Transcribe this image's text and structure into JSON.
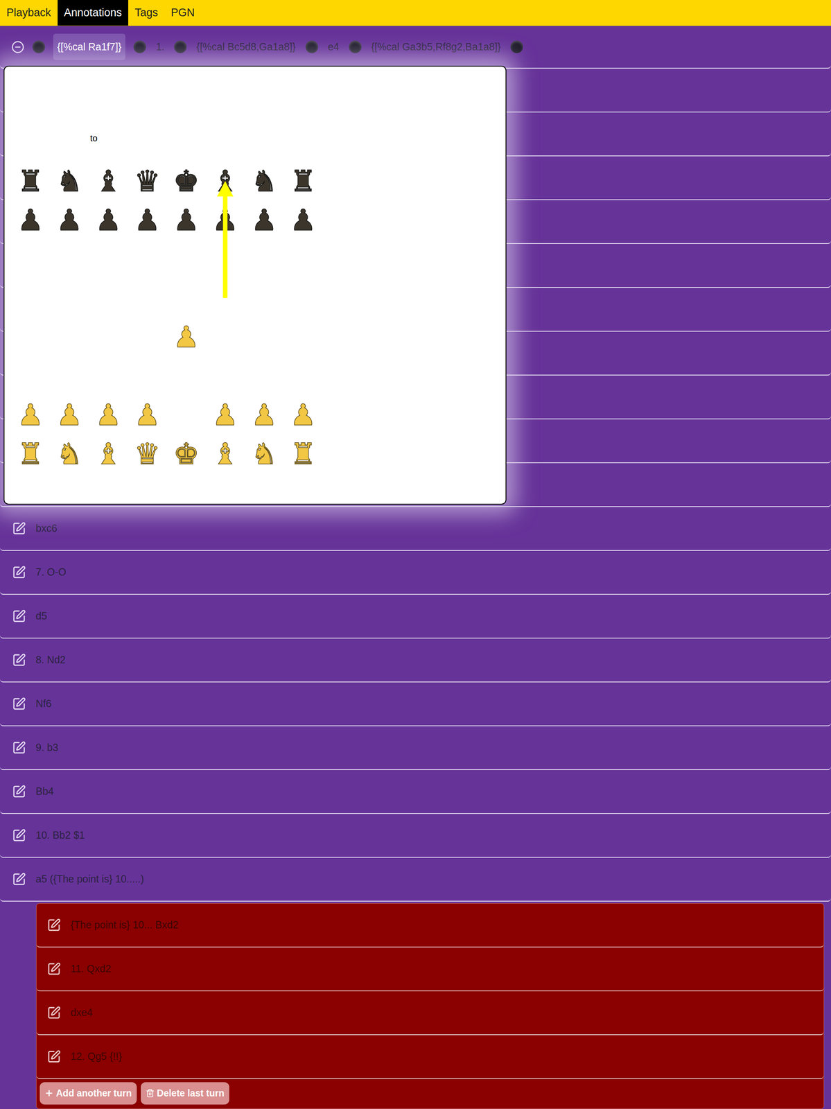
{
  "nav": {
    "tabs": [
      {
        "label": "Playback",
        "selected": false
      },
      {
        "label": "Annotations",
        "selected": true
      },
      {
        "label": "Tags",
        "selected": false
      },
      {
        "label": "PGN",
        "selected": false
      }
    ]
  },
  "first_row": {
    "expanded": true,
    "tokens": [
      {
        "kind": "dot",
        "text": "",
        "selected": false
      },
      {
        "kind": "text",
        "text": "{[%cal Ra1f7]}",
        "selected": true
      },
      {
        "kind": "dot",
        "text": "",
        "selected": false
      },
      {
        "kind": "text",
        "text": "1.",
        "selected": false
      },
      {
        "kind": "dot",
        "text": "",
        "selected": false
      },
      {
        "kind": "text",
        "text": "{[%cal Bc5d8,Ga1a8]}",
        "selected": false
      },
      {
        "kind": "dot",
        "text": "",
        "selected": false
      },
      {
        "kind": "text",
        "text": "e4",
        "selected": false
      },
      {
        "kind": "dot",
        "text": "",
        "selected": false
      },
      {
        "kind": "text",
        "text": "{[%cal Ga3b5,Rf8g2,Ba1a8]}",
        "selected": false
      },
      {
        "kind": "dot",
        "text": "",
        "selected": false
      }
    ]
  },
  "popup": {
    "label": "to",
    "board": {
      "ranks": [
        "♜♞♝♛♚♝♞♜",
        "♟♟♟♟♟♟♟♟",
        "        ",
        "        ",
        "    ♟   ",
        "        ",
        "♟♟♟♟ ♟♟♟",
        "♜♞♝♛♚♝♞♜"
      ],
      "sides": [
        "bbbbbbbb",
        "bbbbbbbb",
        "        ",
        "        ",
        "    w   ",
        "        ",
        "wwww www",
        "wwwwwwww"
      ]
    },
    "arrows": [
      {
        "from": "f5",
        "to": "f8",
        "color": "#ffff00"
      }
    ]
  },
  "moves": [
    "bxc6",
    "7. O-O",
    "d5",
    "8. Nd2",
    "Nf6",
    "9. b3",
    "Bb4",
    "10. Bb2 $1",
    "a5 ({The point is} 10.....)"
  ],
  "variation": {
    "moves": [
      "{The point is} 10... Bxd2",
      "11. Qxd2",
      "dxe4",
      "12. Qg5 {!!}"
    ],
    "buttons": [
      {
        "label": "Add another turn",
        "kind": "add"
      },
      {
        "label": "Delete last turn",
        "kind": "delete"
      }
    ]
  }
}
